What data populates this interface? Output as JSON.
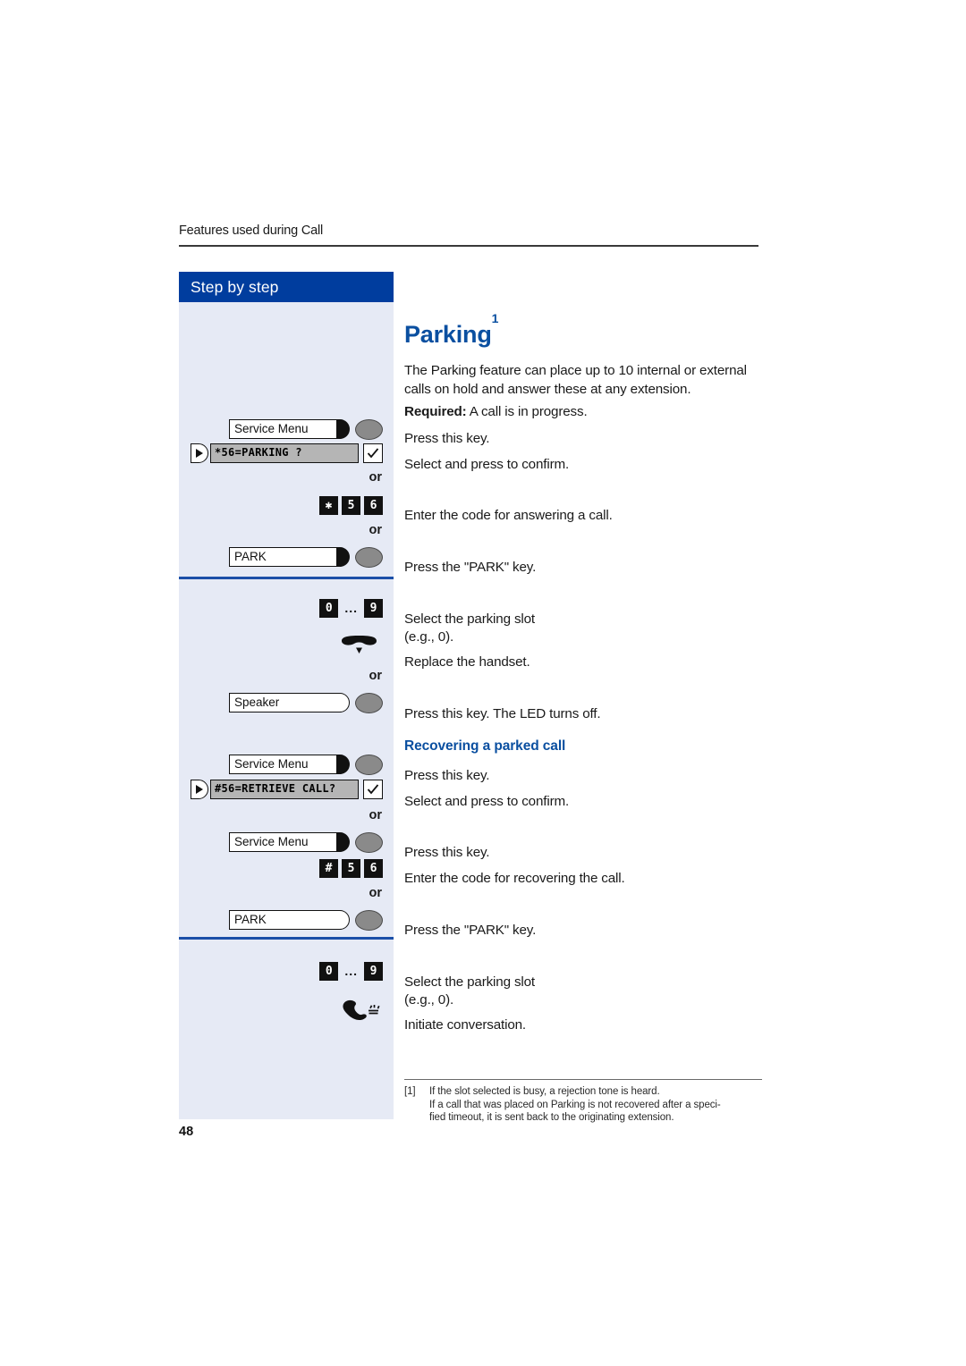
{
  "header": {
    "running_head": "Features used during Call"
  },
  "sidebar": {
    "title": "Step by step",
    "or_label": "or",
    "rows": {
      "service_menu_1": {
        "label": "Service Menu"
      },
      "display_parking": {
        "text": "*56=PARKING ?"
      },
      "code_park": {
        "keys": [
          "✱",
          "5",
          "6"
        ]
      },
      "park_key_1": {
        "label": "PARK"
      },
      "slot_select_1": {
        "keys": [
          "0",
          "9"
        ],
        "dots": "..."
      },
      "speaker_key": {
        "label": "Speaker"
      },
      "service_menu_2": {
        "label": "Service Menu"
      },
      "display_retrieve": {
        "text": "#56=RETRIEVE CALL?"
      },
      "service_menu_3": {
        "label": "Service Menu"
      },
      "code_retrieve": {
        "keys": [
          "#",
          "5",
          "6"
        ]
      },
      "park_key_2": {
        "label": "PARK"
      },
      "slot_select_2": {
        "keys": [
          "0",
          "9"
        ],
        "dots": "..."
      }
    }
  },
  "main": {
    "title": "Parking",
    "title_footnote_marker": "1",
    "intro": "The Parking feature can place up to 10 internal or external calls on hold and answer these at any extension.",
    "required_label": "Required:",
    "required_text": " A call is in progress.",
    "steps": {
      "press_key_1": "Press this key.",
      "select_confirm_1": "Select and press to confirm.",
      "enter_code_answer": "Enter the code for answering a call.",
      "press_park_1": "Press the \"PARK\" key.",
      "select_slot_1": "Select the parking slot",
      "select_slot_1_eg": "(e.g., 0).",
      "replace_handset": "Replace the handset.",
      "press_key_led": "Press this key. The LED turns off."
    },
    "section_heading": "Recovering a parked call",
    "recover_steps": {
      "press_key_2": "Press this key.",
      "select_confirm_2": "Select and press to confirm.",
      "press_key_3": "Press this key.",
      "enter_code_recover": "Enter the code for recovering the call.",
      "press_park_2": "Press the \"PARK\" key.",
      "select_slot_2": "Select the parking slot",
      "select_slot_2_eg": "(e.g., 0).",
      "initiate_conversation": "Initiate conversation."
    }
  },
  "footnote": {
    "marker": "[1]",
    "line1": "If the slot selected is busy, a rejection tone is heard.",
    "line2": "If a call that was placed on Parking is not recovered after a speci-",
    "line3": "fied timeout,  it is sent back to the originating extension."
  },
  "page_number": "48",
  "colors": {
    "accent_blue": "#003d9e",
    "heading_blue": "#0a4fa0",
    "sidebar_bg": "#e6eaf5",
    "divider_blue": "#1b4fa8"
  }
}
